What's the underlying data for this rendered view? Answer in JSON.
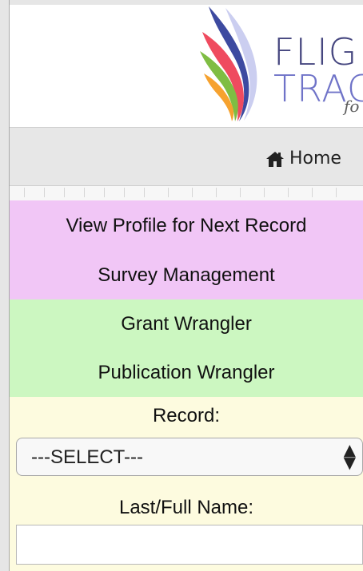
{
  "logo": {
    "line1": "FLIG",
    "line2": "TRAC",
    "sub": "fo"
  },
  "nav": {
    "home_label": "Home"
  },
  "menu": {
    "view_profile": "View Profile for Next Record",
    "survey_management": "Survey Management",
    "grant_wrangler": "Grant Wrangler",
    "publication_wrangler": "Publication Wrangler"
  },
  "form": {
    "record_label": "Record:",
    "record_select_value": "---SELECT---",
    "name_label": "Last/Full Name:",
    "name_value": ""
  },
  "colors": {
    "purple_section": "#f1c6f6",
    "green_section": "#ccf7c1",
    "yellow_section": "#fdfbdf"
  }
}
